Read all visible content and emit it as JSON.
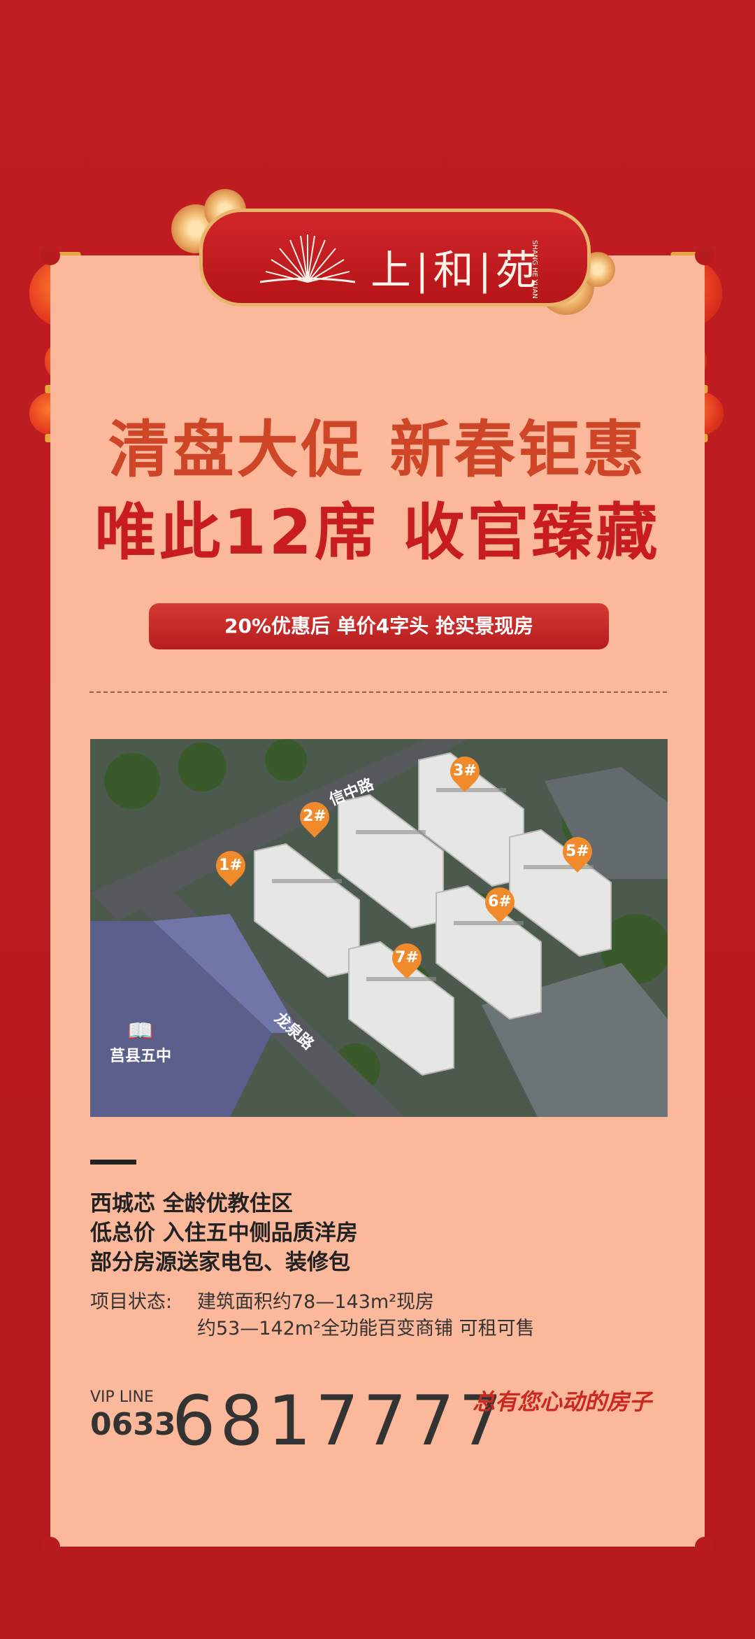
{
  "brand": {
    "name": "上|和|苑",
    "pinyin": "SHANG HE YUAN"
  },
  "headline": {
    "line1": "清盘大促 新春钜惠",
    "line2": "唯此12席 收官臻藏"
  },
  "ribbon": {
    "text": "20%优惠后 单价4字头 抢实景现房"
  },
  "map": {
    "roads": [
      "信中路",
      "龙泉路"
    ],
    "school": "莒县五中",
    "buildings": [
      "1#",
      "2#",
      "3#",
      "5#",
      "6#",
      "7#"
    ]
  },
  "features": [
    "西城芯 全龄优教住区",
    "低总价 入住五中侧品质洋房",
    "部分房源送家电包、装修包"
  ],
  "status": {
    "label": "项目状态:",
    "line1": "建筑面积约78—143m²现房",
    "line2": "约53—142m²全功能百变商铺 可租可售"
  },
  "contact": {
    "vip_label": "VIP LINE",
    "area_code": "0633",
    "phone": "6817777"
  },
  "slogan": "总有您心动的房子"
}
